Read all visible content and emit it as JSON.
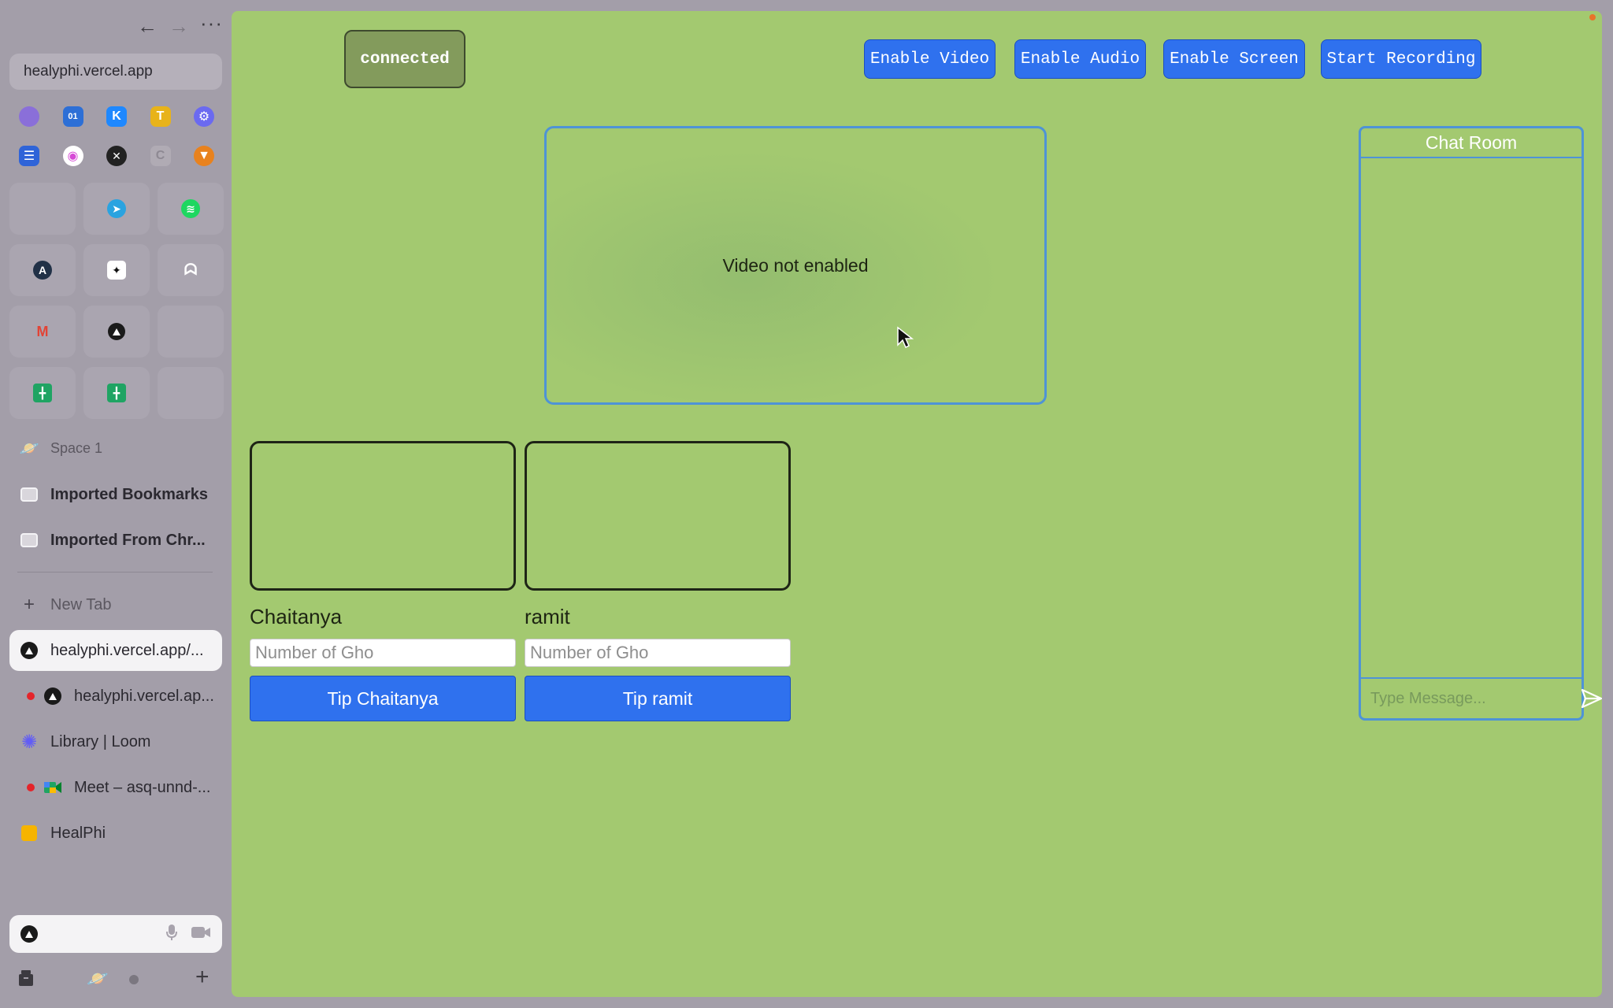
{
  "browser": {
    "url": "healyphi.vercel.app",
    "favorites_row1": [
      {
        "name": "lens-icon",
        "color": "#8a6fd9",
        "glyph": ""
      },
      {
        "name": "outlook-icon",
        "color": "#2d6fd6",
        "glyph": "01"
      },
      {
        "name": "k-app-icon",
        "color": "#1e88ff",
        "glyph": "K"
      },
      {
        "name": "hammer-icon",
        "color": "#e8b31a",
        "glyph": "T"
      },
      {
        "name": "gear-app-icon",
        "color": "#6b6af0",
        "glyph": "⚙"
      }
    ],
    "favorites_row2": [
      {
        "name": "calendar-icon",
        "color": "#2f64d8",
        "glyph": "☰"
      },
      {
        "name": "arc-icon",
        "color": "#d64ad6",
        "glyph": "◉"
      },
      {
        "name": "x-app-icon",
        "color": "#222222",
        "glyph": "✕"
      },
      {
        "name": "c-app-icon",
        "color": "#b0abb4",
        "glyph": "C"
      },
      {
        "name": "metamask-icon",
        "color": "#e8821e",
        "glyph": "🦊"
      }
    ],
    "space_label": "Space 1",
    "folders": [
      "Imported Bookmarks",
      "Imported From Chr..."
    ],
    "new_tab_label": "New Tab",
    "tabs": [
      {
        "label": "healyphi.vercel.app/...",
        "active": true,
        "recording": false
      },
      {
        "label": "healyphi.vercel.ap...",
        "active": false,
        "recording": true
      },
      {
        "label": "Library | Loom",
        "active": false,
        "recording": false
      },
      {
        "label": "Meet – asq-unnd-...",
        "active": false,
        "recording": true
      },
      {
        "label": "HealPhi",
        "active": false,
        "recording": false
      }
    ]
  },
  "app": {
    "status": "connected",
    "buttons": {
      "video": "Enable Video",
      "audio": "Enable Audio",
      "screen": "Enable Screen",
      "record": "Start Recording"
    },
    "video_placeholder": "Video not enabled",
    "peers": [
      {
        "name": "Chaitanya",
        "placeholder": "Number of Gho",
        "tip_label": "Tip Chaitanya"
      },
      {
        "name": "ramit",
        "placeholder": "Number of Gho",
        "tip_label": "Tip ramit"
      }
    ],
    "chat": {
      "title": "Chat Room",
      "placeholder": "Type Message..."
    }
  },
  "colors": {
    "app_background": "#a3c970",
    "primary_button": "#2f71ee",
    "chat_border": "#4e93d6"
  }
}
